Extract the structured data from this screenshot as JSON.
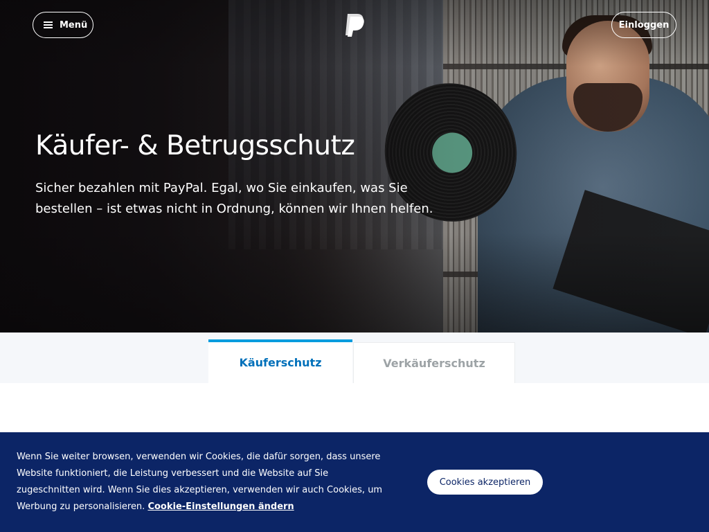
{
  "nav": {
    "menu_label": "Menü",
    "login_label": "Einloggen",
    "logo_icon": "paypal-logo-icon"
  },
  "hero": {
    "title": "Käufer- & Betrugsschutz",
    "subtitle": "Sicher bezahlen mit PayPal. Egal, wo Sie einkaufen, was Sie bestellen – ist etwas nicht in Ordnung, können wir Ihnen helfen."
  },
  "tabs": [
    {
      "label": "Käuferschutz",
      "active": true
    },
    {
      "label": "Verkäuferschutz",
      "active": false
    }
  ],
  "cookie_banner": {
    "text": "Wenn Sie weiter browsen, verwenden wir Cookies, die dafür sorgen, dass unsere Website funktioniert, die Leistung verbessert und die Website auf Sie zugeschnitten wird. Wenn Sie dies akzeptieren, verwenden wir auch Cookies, um Werbung zu personalisieren.",
    "link_label": "Cookie-Einstellungen ändern",
    "accept_label": "Cookies akzeptieren"
  },
  "colors": {
    "brand_blue": "#0070ba",
    "accent_blue": "#009cde",
    "banner_navy": "#0c2566",
    "inactive_tab": "#9da3a6"
  }
}
